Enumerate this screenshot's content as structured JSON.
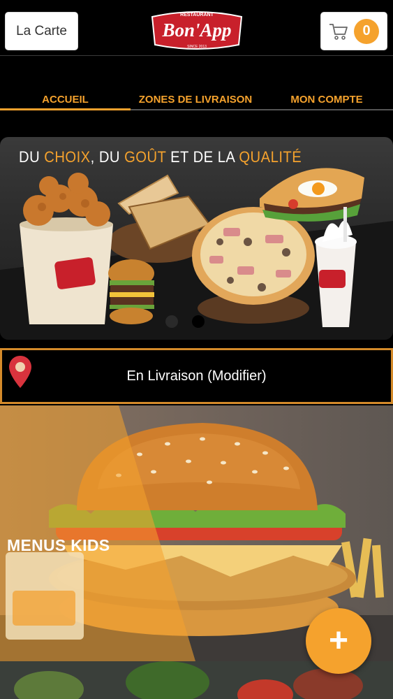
{
  "header": {
    "menu_button_label": "La Carte",
    "logo": {
      "top_text": "RESTAURANT",
      "name": "Bon'App",
      "bottom_text": "SINCE 2013"
    },
    "cart_count": "0"
  },
  "tabs": [
    {
      "label": "ACCUEIL",
      "active": true
    },
    {
      "label": "ZONES DE LIVRAISON",
      "active": false
    },
    {
      "label": "MON COMPTE",
      "active": false
    }
  ],
  "banner": {
    "slogan_parts": [
      "DU ",
      "CHOIX",
      ", DU ",
      "GOÛT",
      " ET DE LA ",
      "QUALITÉ"
    ],
    "slide_count": 2,
    "active_slide": 2
  },
  "delivery": {
    "label": "En Livraison (Modifier)"
  },
  "menu_cards": [
    {
      "title": "MENUS KIDS"
    }
  ],
  "fab": {
    "label": "+"
  },
  "colors": {
    "accent": "#f5a22d",
    "delivery_border": "#d48a2a",
    "pin": "#d8333d",
    "logo_red": "#c8202b"
  }
}
